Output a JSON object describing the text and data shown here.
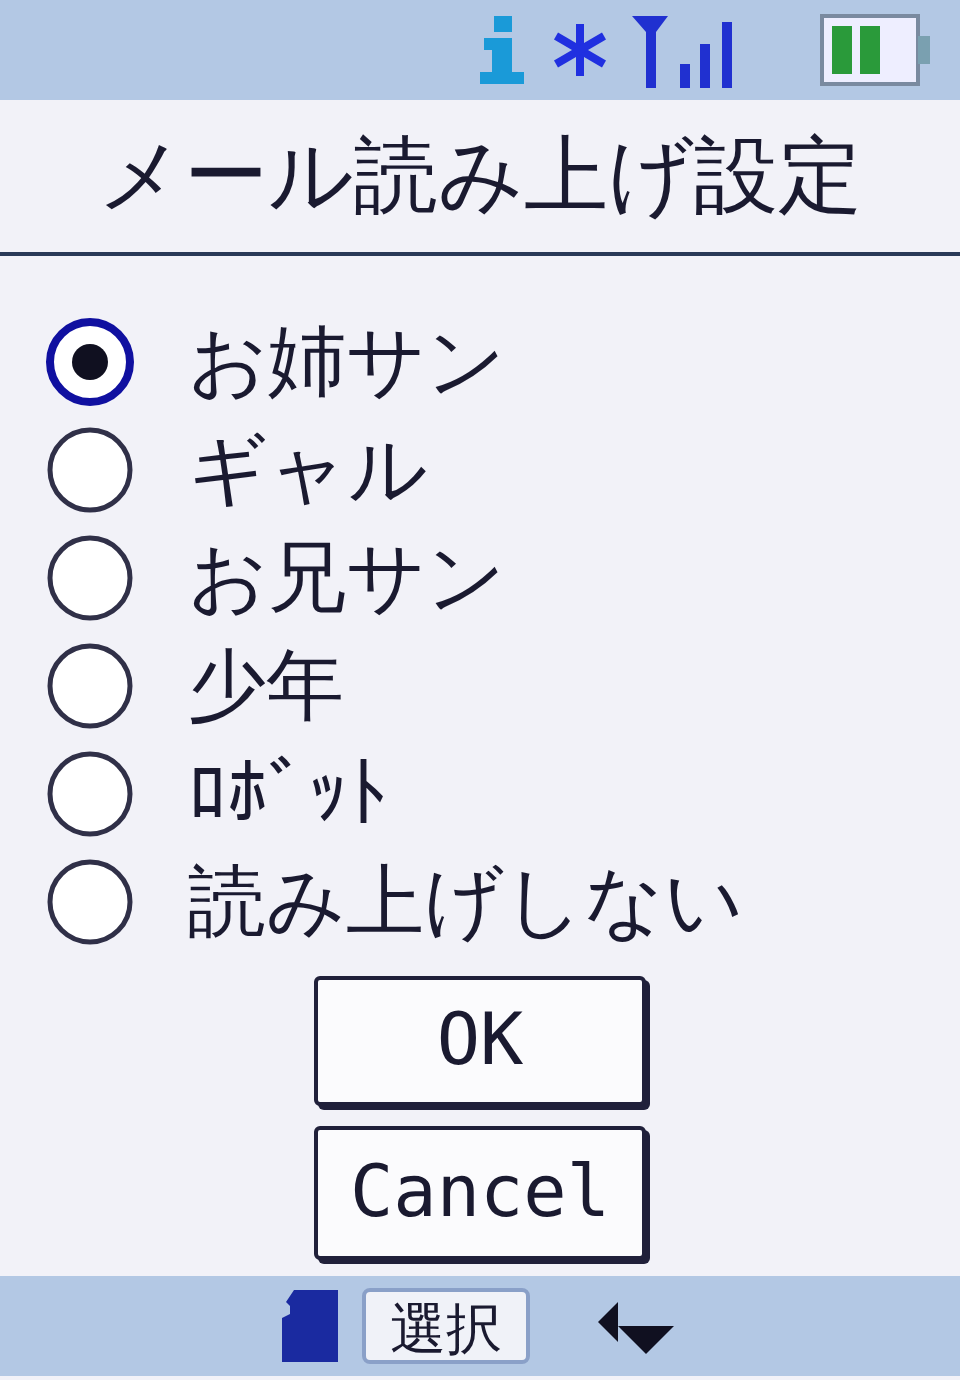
{
  "title": "メール読み上げ設定",
  "options": [
    {
      "label": "お姉サン",
      "selected": true
    },
    {
      "label": "ギャル",
      "selected": false
    },
    {
      "label": "お兄サン",
      "selected": false
    },
    {
      "label": "少年",
      "selected": false
    },
    {
      "label": "ﾛﾎﾞｯﾄ",
      "selected": false
    },
    {
      "label": "読み上げしない",
      "selected": false
    }
  ],
  "buttons": [
    "OK",
    "Cancel"
  ],
  "soft_key": "選択"
}
